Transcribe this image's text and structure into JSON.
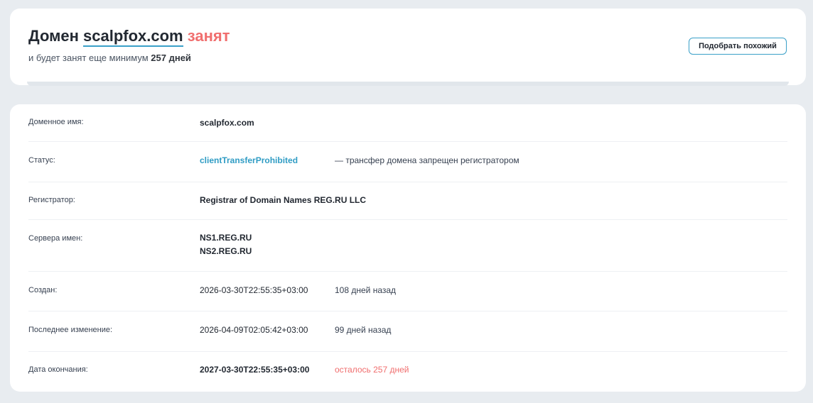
{
  "header": {
    "prefix": "Домен",
    "domain": "scalpfox.com",
    "status_word": "занят",
    "sub_prefix": "и будет занят еще минимум",
    "sub_days": "257 дней",
    "suggest_button": "Подобрать похожий"
  },
  "details": {
    "domain_name": {
      "label": "Доменное имя:",
      "value": "scalpfox.com"
    },
    "status": {
      "label": "Статус:",
      "value": "clientTransferProhibited",
      "note": "— трансфер домена запрещен регистратором"
    },
    "registrar": {
      "label": "Регистратор:",
      "value": "Registrar of Domain Names REG.RU LLC"
    },
    "nameservers": {
      "label": "Сервера имен:",
      "values": [
        "NS1.REG.RU",
        "NS2.REG.RU"
      ]
    },
    "created": {
      "label": "Создан:",
      "value": "2026-03-30T22:55:35+03:00",
      "note": "108 дней назад"
    },
    "modified": {
      "label": "Последнее изменение:",
      "value": "2026-04-09T02:05:42+03:00",
      "note": "99 дней назад"
    },
    "expires": {
      "label": "Дата окончания:",
      "value": "2027-03-30T22:55:35+03:00",
      "note": "осталось 257 дней"
    }
  },
  "colors": {
    "accent": "#2f9cc4",
    "busy": "#f06e6e",
    "background": "#e8ecf0"
  }
}
